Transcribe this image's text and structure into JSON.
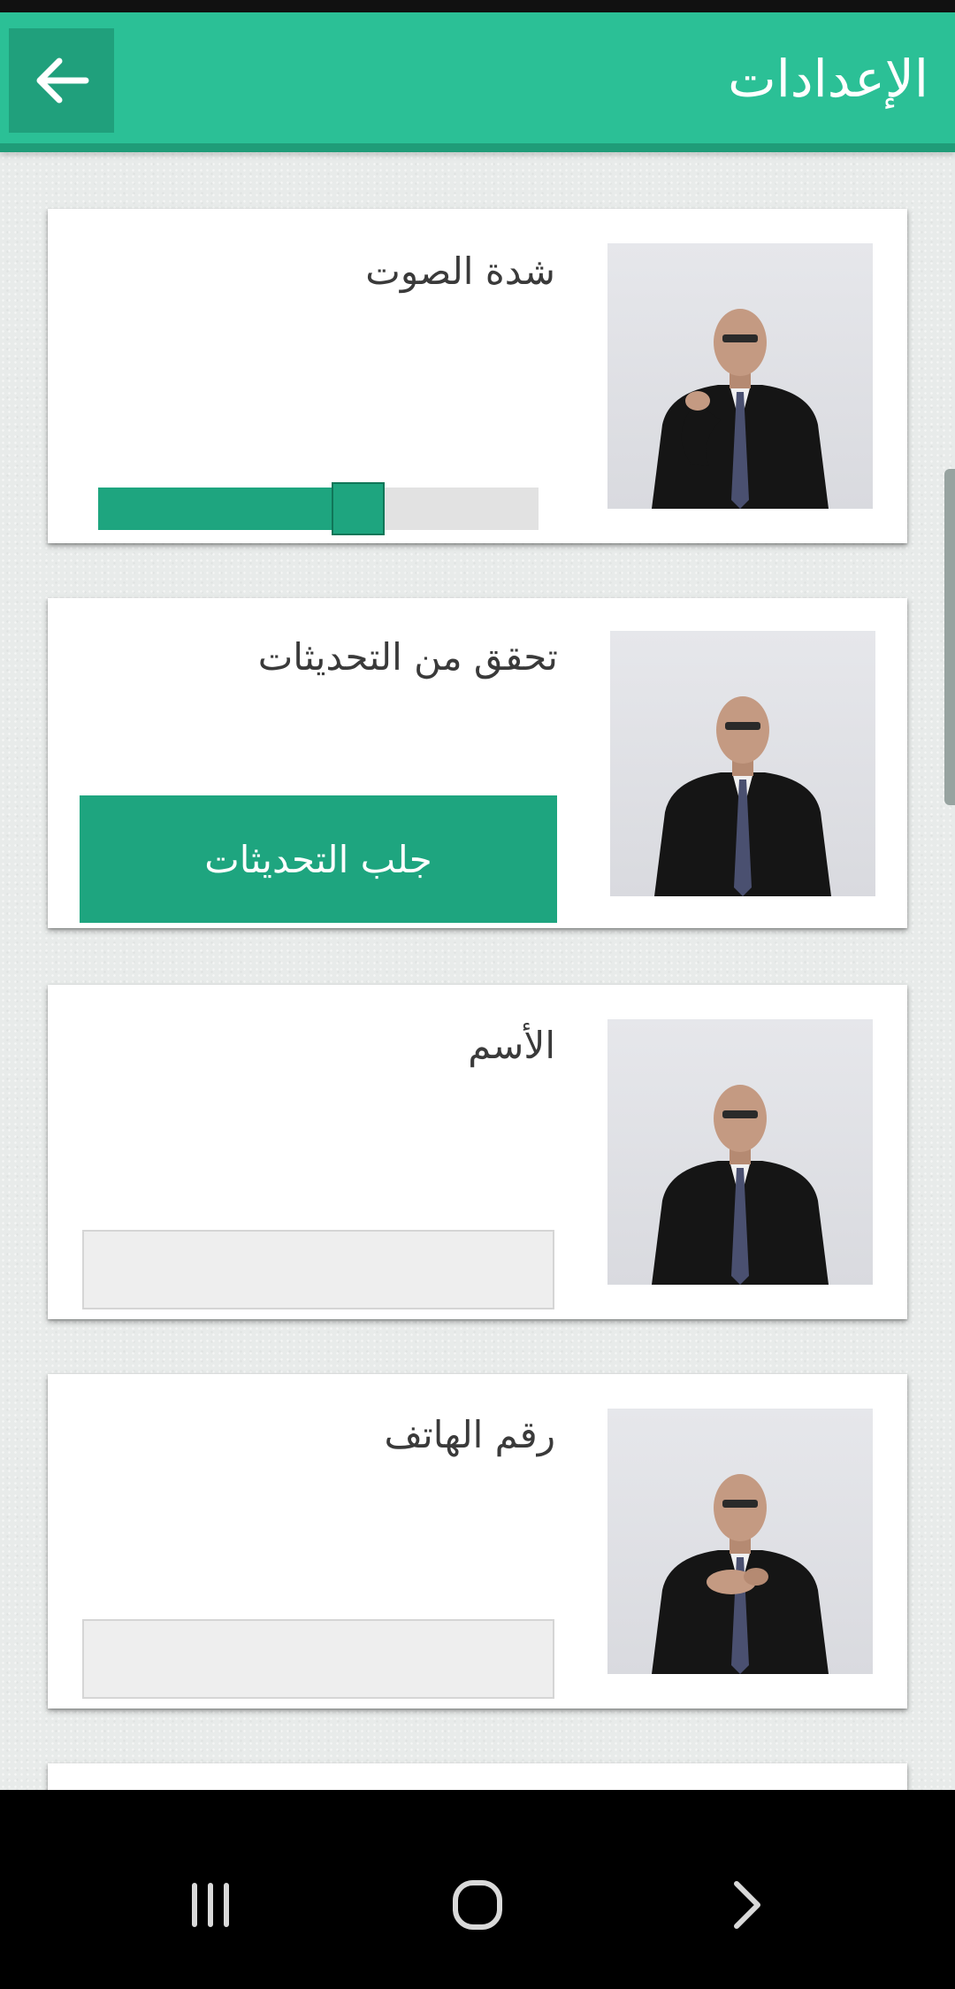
{
  "app_bar": {
    "title": "الإعدادات",
    "back_icon": "arrow-left-icon",
    "background": "#2bc096"
  },
  "settings": {
    "volume": {
      "label": "شدة الصوت",
      "value_percent": 59
    },
    "updates": {
      "label": "تحقق من التحديثات",
      "button_label": "جلب التحديثات"
    },
    "name": {
      "label": "الأسم",
      "value": ""
    },
    "phone": {
      "label": "رقم الهاتف",
      "value": ""
    }
  },
  "colors": {
    "accent": "#1ea57f",
    "header": "#2bc096"
  },
  "nav_bar": {
    "icons": [
      "recent-apps-icon",
      "home-icon",
      "back-chevron-icon"
    ]
  }
}
